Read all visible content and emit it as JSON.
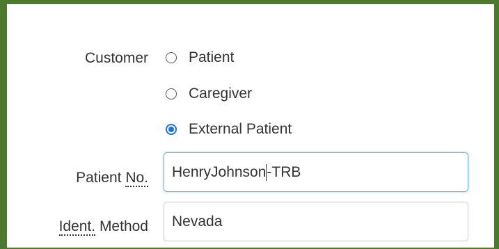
{
  "customer": {
    "label": "Customer",
    "options": [
      {
        "label": "Patient",
        "checked": false
      },
      {
        "label": "Caregiver",
        "checked": false
      },
      {
        "label": "External Patient",
        "checked": true
      }
    ]
  },
  "patient_no": {
    "label_abbr": "No.",
    "label_prefix": "Patient ",
    "value_before_caret": "HenryJohnson",
    "value_after_caret": "-TRB"
  },
  "ident_method": {
    "label_abbr": "Ident.",
    "label_suffix": " Method",
    "value": "Nevada"
  },
  "colors": {
    "frame_border": "#4b7a2c",
    "radio_checked": "#1a73e8",
    "focus_border": "#66afe9"
  }
}
